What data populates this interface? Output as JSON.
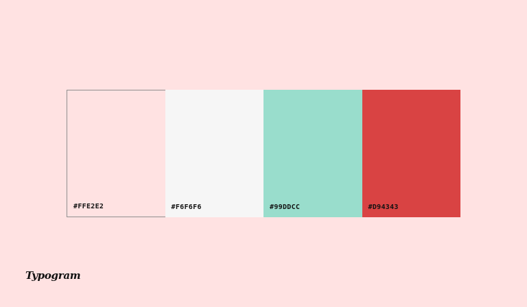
{
  "palette": {
    "swatches": [
      {
        "hex": "#FFE2E2",
        "label": "#FFE2E2"
      },
      {
        "hex": "#F6F6F6",
        "label": "#F6F6F6"
      },
      {
        "hex": "#99DDCC",
        "label": "#99DDCC"
      },
      {
        "hex": "#D94343",
        "label": "#D94343"
      }
    ]
  },
  "brand": {
    "name": "Typogram"
  },
  "colors": {
    "background": "#FFE2E2",
    "text": "#111111"
  }
}
